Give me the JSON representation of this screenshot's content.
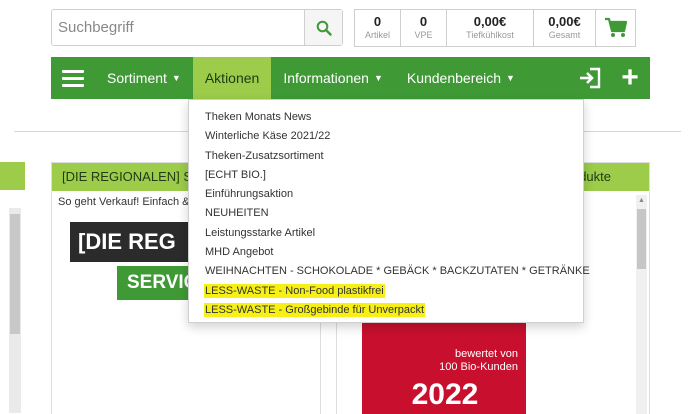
{
  "search": {
    "placeholder": "Suchbegriff"
  },
  "summary": [
    {
      "value": "0",
      "label": "Artikel"
    },
    {
      "value": "0",
      "label": "VPE"
    },
    {
      "value": "0,00€",
      "label": "Tiefkühlkost"
    },
    {
      "value": "0,00€",
      "label": "Gesamt"
    }
  ],
  "nav": {
    "items": [
      {
        "label": "Sortiment",
        "caret": "▼"
      },
      {
        "label": "Aktionen"
      },
      {
        "label": "Informationen",
        "caret": "▼"
      },
      {
        "label": "Kundenbereich",
        "caret": "▼"
      }
    ],
    "plus": "+"
  },
  "dropdown": {
    "items": [
      "Theken Monats News",
      "Winterliche Käse 2021/22",
      "Theken-Zusatzsortiment",
      "[ECHT BIO.]",
      "Einführungsaktion",
      "NEUHEITEN",
      "Leistungsstarke Artikel",
      "MHD Angebot",
      "WEIHNACHTEN - SCHOKOLADE * GEBÄCK * BACKZUTATEN * GETRÄNKE",
      "LESS-WASTE - Non-Food plastikfrei",
      "LESS-WASTE - Großgebinde für Unverpackt"
    ]
  },
  "cards": {
    "card1": {
      "title": "[DIE REGIONALEN] Service",
      "subtitle": "So geht Verkauf! Einfach & gut"
    },
    "card2": {
      "title": "Neue Bio-Produkte"
    }
  },
  "promo": {
    "brand": "[DIE REG",
    "service": "SERVICE",
    "badge_line1": "bewertet von",
    "badge_line2": "100 Bio-Kunden",
    "badge_year": "2022"
  },
  "colors": {
    "nav_green": "#3f9a36",
    "accent_green": "#9ccc4a",
    "highlight": "#f7f016"
  }
}
